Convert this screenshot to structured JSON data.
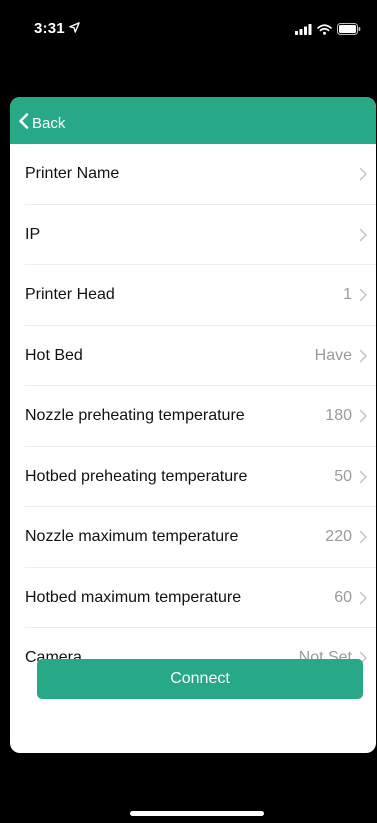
{
  "status_bar": {
    "time": "3:31",
    "location_icon": "location-arrow-icon",
    "signal_icon": "cellular-signal-icon",
    "wifi_icon": "wifi-icon",
    "battery_icon": "battery-icon"
  },
  "nav": {
    "back_label": "Back",
    "back_icon": "chevron-left-icon"
  },
  "settings": {
    "rows": [
      {
        "label": "Printer Name",
        "value": ""
      },
      {
        "label": "IP",
        "value": ""
      },
      {
        "label": "Printer Head",
        "value": "1"
      },
      {
        "label": "Hot Bed",
        "value": "Have"
      },
      {
        "label": "Nozzle preheating temperature",
        "value": "180"
      },
      {
        "label": "Hotbed preheating temperature",
        "value": "50"
      },
      {
        "label": "Nozzle maximum temperature",
        "value": "220"
      },
      {
        "label": "Hotbed maximum temperature",
        "value": "60"
      },
      {
        "label": "Camera",
        "value": "Not Set"
      }
    ],
    "row_icon": "chevron-right-icon"
  },
  "actions": {
    "connect_label": "Connect"
  },
  "colors": {
    "accent": "#27a886",
    "background": "#000000",
    "sheet": "#ffffff",
    "value_text": "#9a9a9a",
    "separator": "#ececec"
  }
}
